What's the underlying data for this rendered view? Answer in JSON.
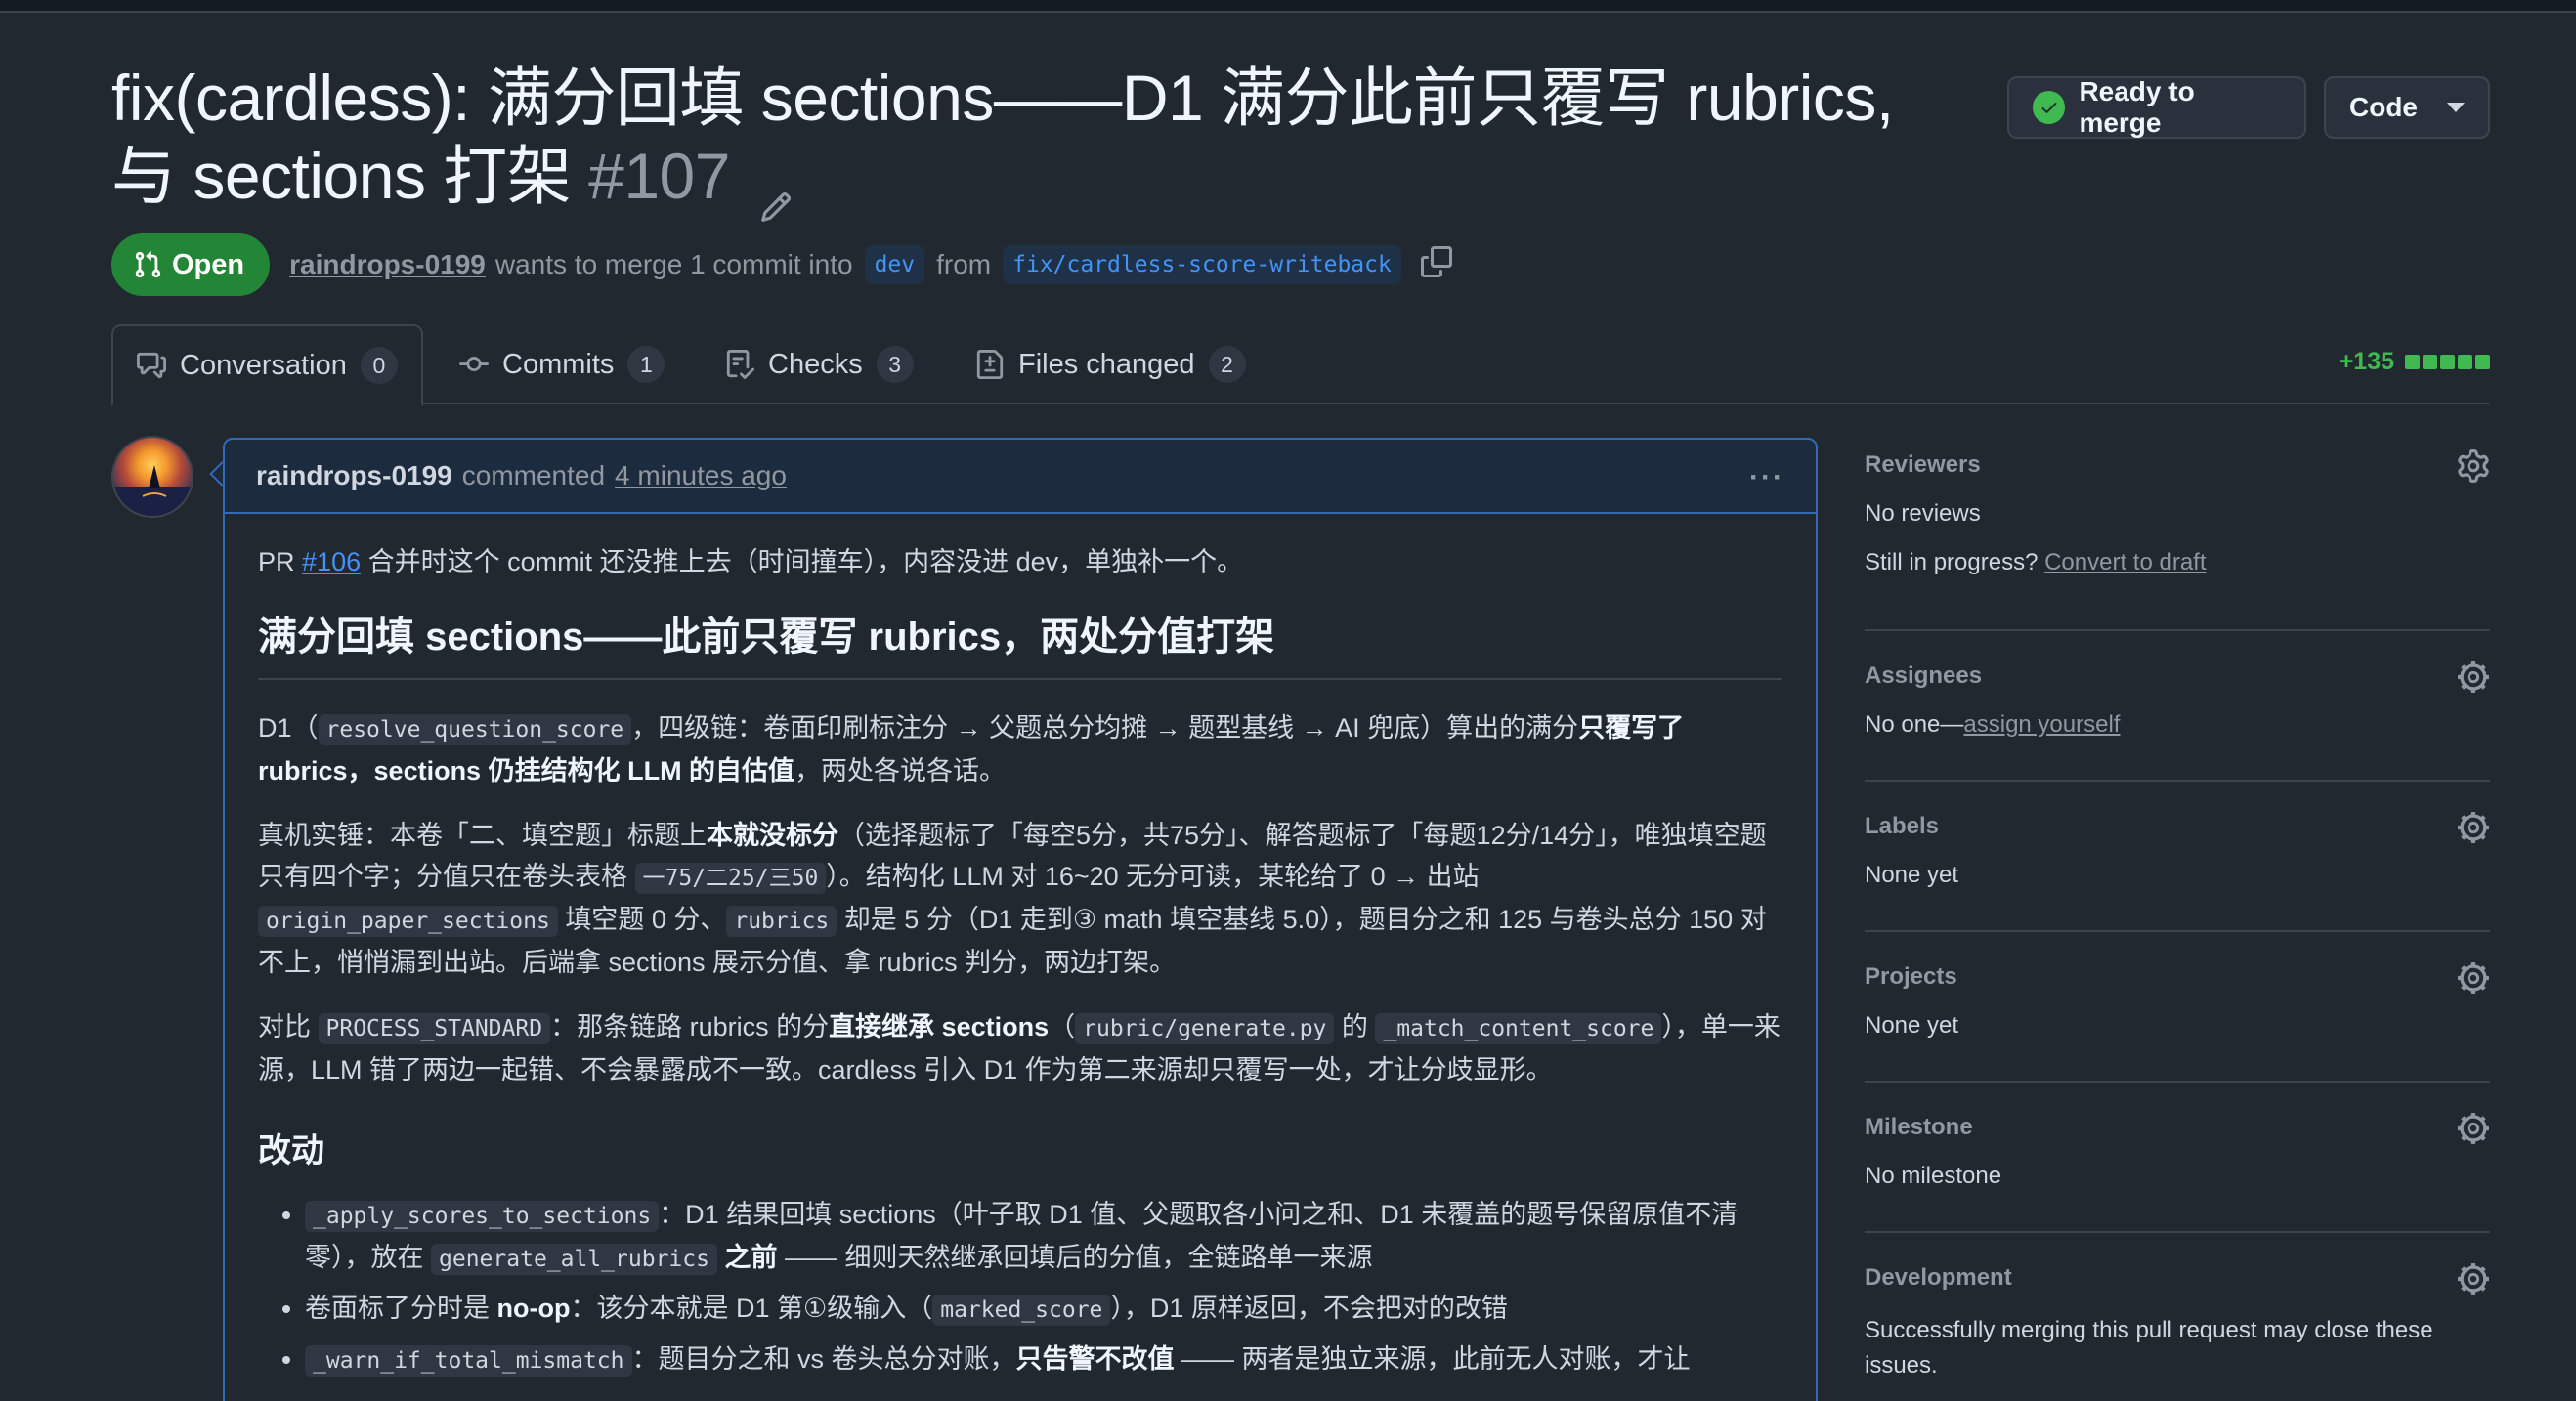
{
  "header": {
    "title_line": "fix(cardless): 满分回填 sections——D1 满分此前只覆写 rubrics,与 sections 打架",
    "number": "#107",
    "ready_label": "Ready to merge",
    "code_label": "Code"
  },
  "state": {
    "badge": "Open",
    "author": "raindrops-0199",
    "wants_text": "wants to merge 1 commit into",
    "base_branch": "dev",
    "from_text": "from",
    "head_branch": "fix/cardless-score-writeback"
  },
  "tabs": [
    {
      "label": "Conversation",
      "count": "0",
      "icon": "conversation-icon"
    },
    {
      "label": "Commits",
      "count": "1",
      "icon": "commit-icon"
    },
    {
      "label": "Checks",
      "count": "3",
      "icon": "checks-icon"
    },
    {
      "label": "Files changed",
      "count": "2",
      "icon": "file-diff-icon"
    }
  ],
  "diffstat": {
    "additions": "+135",
    "bar_filled_fraction": 1.0
  },
  "comment": {
    "author": "raindrops-0199",
    "action": "commented",
    "time": "4 minutes ago",
    "p1_pre": "PR",
    "p1_link": "#106",
    "p1_post": "合并时这个 commit 还没推上去（时间撞车），内容没进 dev，单独补一个。",
    "h2": "满分回填 sections——此前只覆写 rubrics，两处分值打架",
    "p2": {
      "a": "D1（",
      "code1": "resolve_question_score",
      "b": "，四级链：卷面印刷标注分 → 父题总分均摊 → 题型基线 → AI 兜底）算出的满分",
      "b_bold": "只覆写了 rubrics，sections 仍挂结构化 LLM 的自估值",
      "c": "，两处各说各话。"
    },
    "p3": {
      "a": "真机实锤：本卷「二、填空题」标题上",
      "bold": "本就没标分",
      "b": "（选择题标了「每空5分，共75分」、解答题标了「每题12分/14分」，唯独填空题只有四个字；分值只在卷头表格",
      "code1": "一75/二25/三50",
      "c": "）。结构化 LLM 对 16~20 无分可读，某轮给了 0 → 出站",
      "code2": "origin_paper_sections",
      "d": "填空题 0 分、",
      "code3": "rubrics",
      "e": "却是 5 分（D1 走到③ math 填空基线 5.0），题目分之和 125 与卷头总分 150 对不上，悄悄漏到出站。后端拿 sections 展示分值、拿 rubrics 判分，两边打架。"
    },
    "p4": {
      "a": "对比",
      "code1": "PROCESS_STANDARD",
      "b": "：那条链路 rubrics 的分",
      "bold": "直接继承 sections",
      "c": "（",
      "code2": "rubric/generate.py",
      "d": "的",
      "code3": "_match_content_score",
      "e": "），单一来源，LLM 错了两边一起错、不会暴露成不一致。cardless 引入 D1 作为第二来源却只覆写一处，才让分歧显形。"
    },
    "h3": "改动",
    "li1": {
      "code1": "_apply_scores_to_sections",
      "a": "：D1 结果回填 sections（叶子取 D1 值、父题取各小问之和、D1 未覆盖的题号保留原值不清零），放在",
      "code2": "generate_all_rubrics",
      "bold": "之前",
      "b": "—— 细则天然继承回填后的分值，全链路单一来源"
    },
    "li2": {
      "a": "卷面标了分时是",
      "bold": "no-op",
      "b": "：该分本就是 D1 第①级输入（",
      "code1": "marked_score",
      "c": "），D1 原样返回，不会把对的改错"
    },
    "li3": {
      "code1": "_warn_if_total_mismatch",
      "a": "：题目分之和 vs 卷头总分对账，",
      "bold": "只告警不改值",
      "b": "—— 两者是独立来源，此前无人对账，才让"
    }
  },
  "sidebar": {
    "reviewers": {
      "title": "Reviewers",
      "value": "No reviews",
      "hint": "Still in progress?",
      "link": "Convert to draft"
    },
    "assignees": {
      "title": "Assignees",
      "value": "No one—",
      "link": "assign yourself"
    },
    "labels": {
      "title": "Labels",
      "value": "None yet"
    },
    "projects": {
      "title": "Projects",
      "value": "None yet"
    },
    "milestone": {
      "title": "Milestone",
      "value": "No milestone"
    },
    "development": {
      "title": "Development",
      "value": "Successfully merging this pull request may close these issues."
    }
  },
  "colors": {
    "accent": "#4493f8",
    "success": "#238636",
    "background": "#212830"
  }
}
